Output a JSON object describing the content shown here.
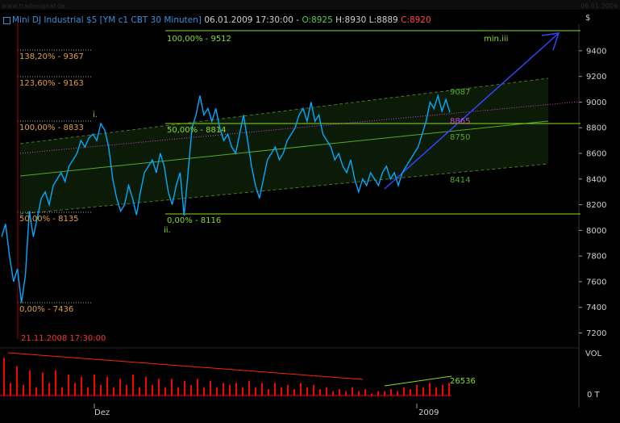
{
  "window": {
    "source": "www.tradesignal.de",
    "date_right": "06.01.2009"
  },
  "header": {
    "instrument": "Mini DJ Industrial $5 [YM c1 CBT  30 Minuten]",
    "datetime": "06.01.2009 17:30:00",
    "dash": "-",
    "open": "O:8925",
    "high": "H:8930",
    "low": "L:8889",
    "close": "C:8920"
  },
  "colors": {
    "background": "#000000",
    "price_line": "#00aaff",
    "fib_text": "#e0a040",
    "green_line": "#88dd22",
    "channel": "#447722",
    "magenta": "#cc44cc",
    "blue_arrow": "#3344ff",
    "volume": "#ff0000",
    "red_trend": "#ff2200",
    "axis_text": "#cfcfcf",
    "header_text": "#3a8fd8"
  },
  "annotations": {
    "fib_138": "138,20% - 9367",
    "fib_123": "123,60% - 9163",
    "fib_100": "100,00% - 8833",
    "fib_50": "50,00% - 8135",
    "fib_0": "0,00% - 7436",
    "start_date": "21.11.2008 17:30:00",
    "ret_100": "100,00% - 9512",
    "ret_50": "50,00% - 8814",
    "ret_0": "0,00% - 8116",
    "wave_i": "i.",
    "wave_ii": "ii.",
    "wave_target": "min.iii",
    "ch_upper": "9087",
    "ch_mid": "8750",
    "ch_lower": "8414",
    "magenta_val": "8865"
  },
  "chart_data": {
    "type": "line",
    "interval": "30 Minuten",
    "yaxis": {
      "unit": "$",
      "ticks": [
        9400,
        9200,
        9000,
        8800,
        8600,
        8400,
        8200,
        8000,
        7800,
        7600,
        7400,
        7200
      ],
      "ylim": [
        7100,
        9560
      ]
    },
    "xaxis": {
      "ticks": [
        "Dez",
        "2009"
      ]
    },
    "ohlc_last": {
      "time": "06.01.2009 17:30:00",
      "open": 8925,
      "high": 8930,
      "low": 8889,
      "close": 8920
    },
    "price_series": {
      "name": "YM c1 CBT",
      "values": [
        7950,
        8050,
        7800,
        7600,
        7700,
        7436,
        7650,
        8150,
        7950,
        8100,
        8250,
        8300,
        8200,
        8350,
        8400,
        8450,
        8380,
        8500,
        8550,
        8600,
        8700,
        8650,
        8720,
        8750,
        8700,
        8833,
        8780,
        8650,
        8400,
        8250,
        8150,
        8200,
        8350,
        8250,
        8120,
        8300,
        8450,
        8500,
        8550,
        8450,
        8600,
        8500,
        8300,
        8200,
        8350,
        8450,
        8116,
        8450,
        8800,
        8900,
        9050,
        8900,
        8950,
        8850,
        8950,
        8800,
        8700,
        8750,
        8650,
        8600,
        8750,
        8900,
        8700,
        8500,
        8350,
        8250,
        8400,
        8550,
        8600,
        8650,
        8550,
        8600,
        8700,
        8750,
        8800,
        8900,
        8950,
        8850,
        9000,
        8850,
        8900,
        8750,
        8700,
        8650,
        8550,
        8600,
        8500,
        8450,
        8550,
        8400,
        8300,
        8400,
        8350,
        8450,
        8400,
        8350,
        8450,
        8500,
        8400,
        8450,
        8350,
        8450,
        8500,
        8550,
        8600,
        8650,
        8750,
        8850,
        9000,
        8950,
        9050,
        8930,
        9020,
        8920
      ]
    },
    "volume": {
      "label": "VOL",
      "zero_label": "0 T",
      "last": "26536",
      "values": [
        0.9,
        0.3,
        0.7,
        0.25,
        0.6,
        0.2,
        0.55,
        0.3,
        0.6,
        0.2,
        0.5,
        0.3,
        0.45,
        0.2,
        0.5,
        0.25,
        0.45,
        0.2,
        0.4,
        0.25,
        0.5,
        0.2,
        0.45,
        0.25,
        0.4,
        0.2,
        0.4,
        0.2,
        0.35,
        0.25,
        0.4,
        0.2,
        0.35,
        0.2,
        0.3,
        0.25,
        0.3,
        0.2,
        0.35,
        0.2,
        0.3,
        0.15,
        0.3,
        0.2,
        0.25,
        0.15,
        0.3,
        0.2,
        0.25,
        0.15,
        0.2,
        0.1,
        0.15,
        0.1,
        0.2,
        0.1,
        0.15,
        0.05,
        0.1,
        0.1,
        0.15,
        0.1,
        0.2,
        0.15,
        0.25,
        0.2,
        0.3,
        0.2,
        0.25,
        0.3
      ]
    },
    "levels": [
      {
        "label": "100,00% - 9512",
        "value": 9512
      },
      {
        "label": "100,00% - 8833",
        "value": 8833
      },
      {
        "label": "0,00% - 8116",
        "value": 8116
      }
    ]
  }
}
